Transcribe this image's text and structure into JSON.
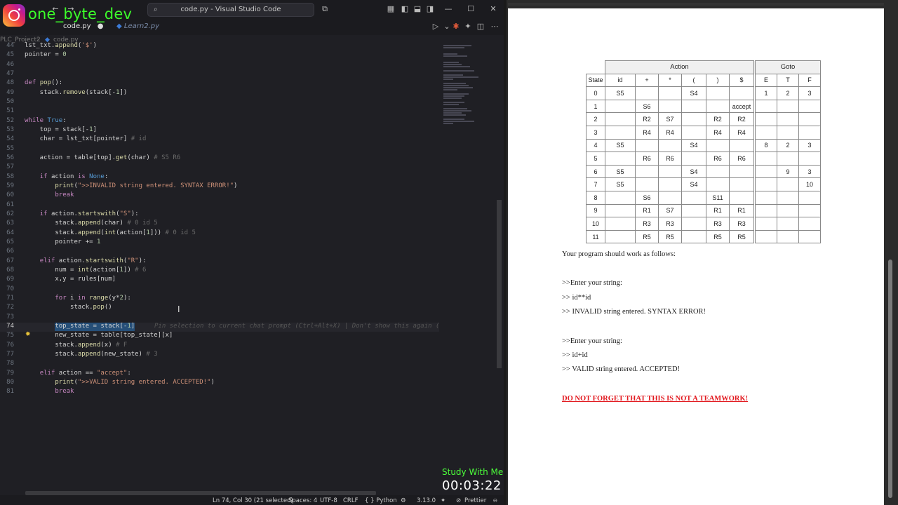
{
  "brand": {
    "handle": "one_byte_dev",
    "icon": "instagram-icon"
  },
  "window": {
    "title": "code.py - Visual Studio Code"
  },
  "tabs": [
    {
      "label": "code.py",
      "modified": true
    },
    {
      "label": "Learn2.py"
    }
  ],
  "breadcrumb": {
    "project": "PLC_Project2",
    "file": "code.py"
  },
  "editor": {
    "inline_hint": "Pin selection to current chat prompt (Ctrl+Alt+X) | Don't show this again (",
    "lines": [
      {
        "n": "44",
        "text": "lst_txt.append('$')"
      },
      {
        "n": "45",
        "text": "pointer = 0"
      },
      {
        "n": "46",
        "text": ""
      },
      {
        "n": "47",
        "text": ""
      },
      {
        "n": "48",
        "text": "def pop():"
      },
      {
        "n": "49",
        "text": "    stack.remove(stack[-1])"
      },
      {
        "n": "50",
        "text": ""
      },
      {
        "n": "51",
        "text": ""
      },
      {
        "n": "52",
        "text": "while True:"
      },
      {
        "n": "53",
        "text": "    top = stack[-1]"
      },
      {
        "n": "54",
        "text": "    char = lst_txt[pointer] # id"
      },
      {
        "n": "55",
        "text": ""
      },
      {
        "n": "56",
        "text": "    action = table[top].get(char) # S5 R6"
      },
      {
        "n": "57",
        "text": ""
      },
      {
        "n": "58",
        "text": "    if action is None:"
      },
      {
        "n": "59",
        "text": "        print(\">>INVALID string entered. SYNTAX ERROR!\")"
      },
      {
        "n": "60",
        "text": "        break"
      },
      {
        "n": "61",
        "text": ""
      },
      {
        "n": "62",
        "text": "    if action.startswith(\"S\"):"
      },
      {
        "n": "63",
        "text": "        stack.append(char) # 0 id 5"
      },
      {
        "n": "64",
        "text": "        stack.append(int(action[1])) # 0 id 5"
      },
      {
        "n": "65",
        "text": "        pointer += 1"
      },
      {
        "n": "66",
        "text": ""
      },
      {
        "n": "67",
        "text": "    elif action.startswith(\"R\"):"
      },
      {
        "n": "68",
        "text": "        num = int(action[1]) # 6"
      },
      {
        "n": "69",
        "text": "        x,y = rules[num]"
      },
      {
        "n": "70",
        "text": ""
      },
      {
        "n": "71",
        "text": "        for i in range(y*2):"
      },
      {
        "n": "72",
        "text": "            stack.pop()"
      },
      {
        "n": "73",
        "text": ""
      },
      {
        "n": "74",
        "text": "        top_state = stack[-1]"
      },
      {
        "n": "75",
        "text": "        new_state = table[top_state][x]"
      },
      {
        "n": "76",
        "text": "        stack.append(x) # F"
      },
      {
        "n": "77",
        "text": "        stack.append(new_state) # 3"
      },
      {
        "n": "78",
        "text": ""
      },
      {
        "n": "79",
        "text": "    elif action == \"accept\":"
      },
      {
        "n": "80",
        "text": "        print(\">>VALID string entered. ACCEPTED!\")"
      },
      {
        "n": "81",
        "text": "        break"
      }
    ]
  },
  "status": {
    "cursor": "Ln 74, Col 30 (21 selected)",
    "spaces": "Spaces: 4",
    "encoding": "UTF-8",
    "eol": "CRLF",
    "language": "{ } Python",
    "version": "3.13.0",
    "formatter": "Prettier"
  },
  "overlay": {
    "label": "Study With Me",
    "timer": "00:03:22"
  },
  "parse_table": {
    "group_headers": [
      "Action",
      "Goto"
    ],
    "columns": [
      "State",
      "id",
      "+",
      "*",
      "(",
      ")",
      "$",
      "E",
      "T",
      "F"
    ],
    "rows": [
      [
        "0",
        "S5",
        "",
        "",
        "S4",
        "",
        "",
        "1",
        "2",
        "3"
      ],
      [
        "1",
        "",
        "S6",
        "",
        "",
        "",
        "accept",
        "",
        "",
        ""
      ],
      [
        "2",
        "",
        "R2",
        "S7",
        "",
        "R2",
        "R2",
        "",
        "",
        ""
      ],
      [
        "3",
        "",
        "R4",
        "R4",
        "",
        "R4",
        "R4",
        "",
        "",
        ""
      ],
      [
        "4",
        "S5",
        "",
        "",
        "S4",
        "",
        "",
        "8",
        "2",
        "3"
      ],
      [
        "5",
        "",
        "R6",
        "R6",
        "",
        "R6",
        "R6",
        "",
        "",
        ""
      ],
      [
        "6",
        "S5",
        "",
        "",
        "S4",
        "",
        "",
        "",
        "9",
        "3"
      ],
      [
        "7",
        "S5",
        "",
        "",
        "S4",
        "",
        "",
        "",
        "",
        "10"
      ],
      [
        "8",
        "",
        "S6",
        "",
        "",
        "S11",
        "",
        "",
        "",
        ""
      ],
      [
        "9",
        "",
        "R1",
        "S7",
        "",
        "R1",
        "R1",
        "",
        "",
        ""
      ],
      [
        "10",
        "",
        "R3",
        "R3",
        "",
        "R3",
        "R3",
        "",
        "",
        ""
      ],
      [
        "11",
        "",
        "R5",
        "R5",
        "",
        "R5",
        "R5",
        "",
        "",
        ""
      ]
    ]
  },
  "doc": {
    "intro": "Your program should work as follows:",
    "example1": [
      ">>Enter your string:",
      ">> id**id",
      ">> INVALID string entered. SYNTAX ERROR!"
    ],
    "example2": [
      ">>Enter your string:",
      ">> id+id",
      ">> VALID string entered. ACCEPTED!"
    ],
    "warning": "DO NOT FORGET THAT THIS IS NOT A TEAMWORK!"
  }
}
